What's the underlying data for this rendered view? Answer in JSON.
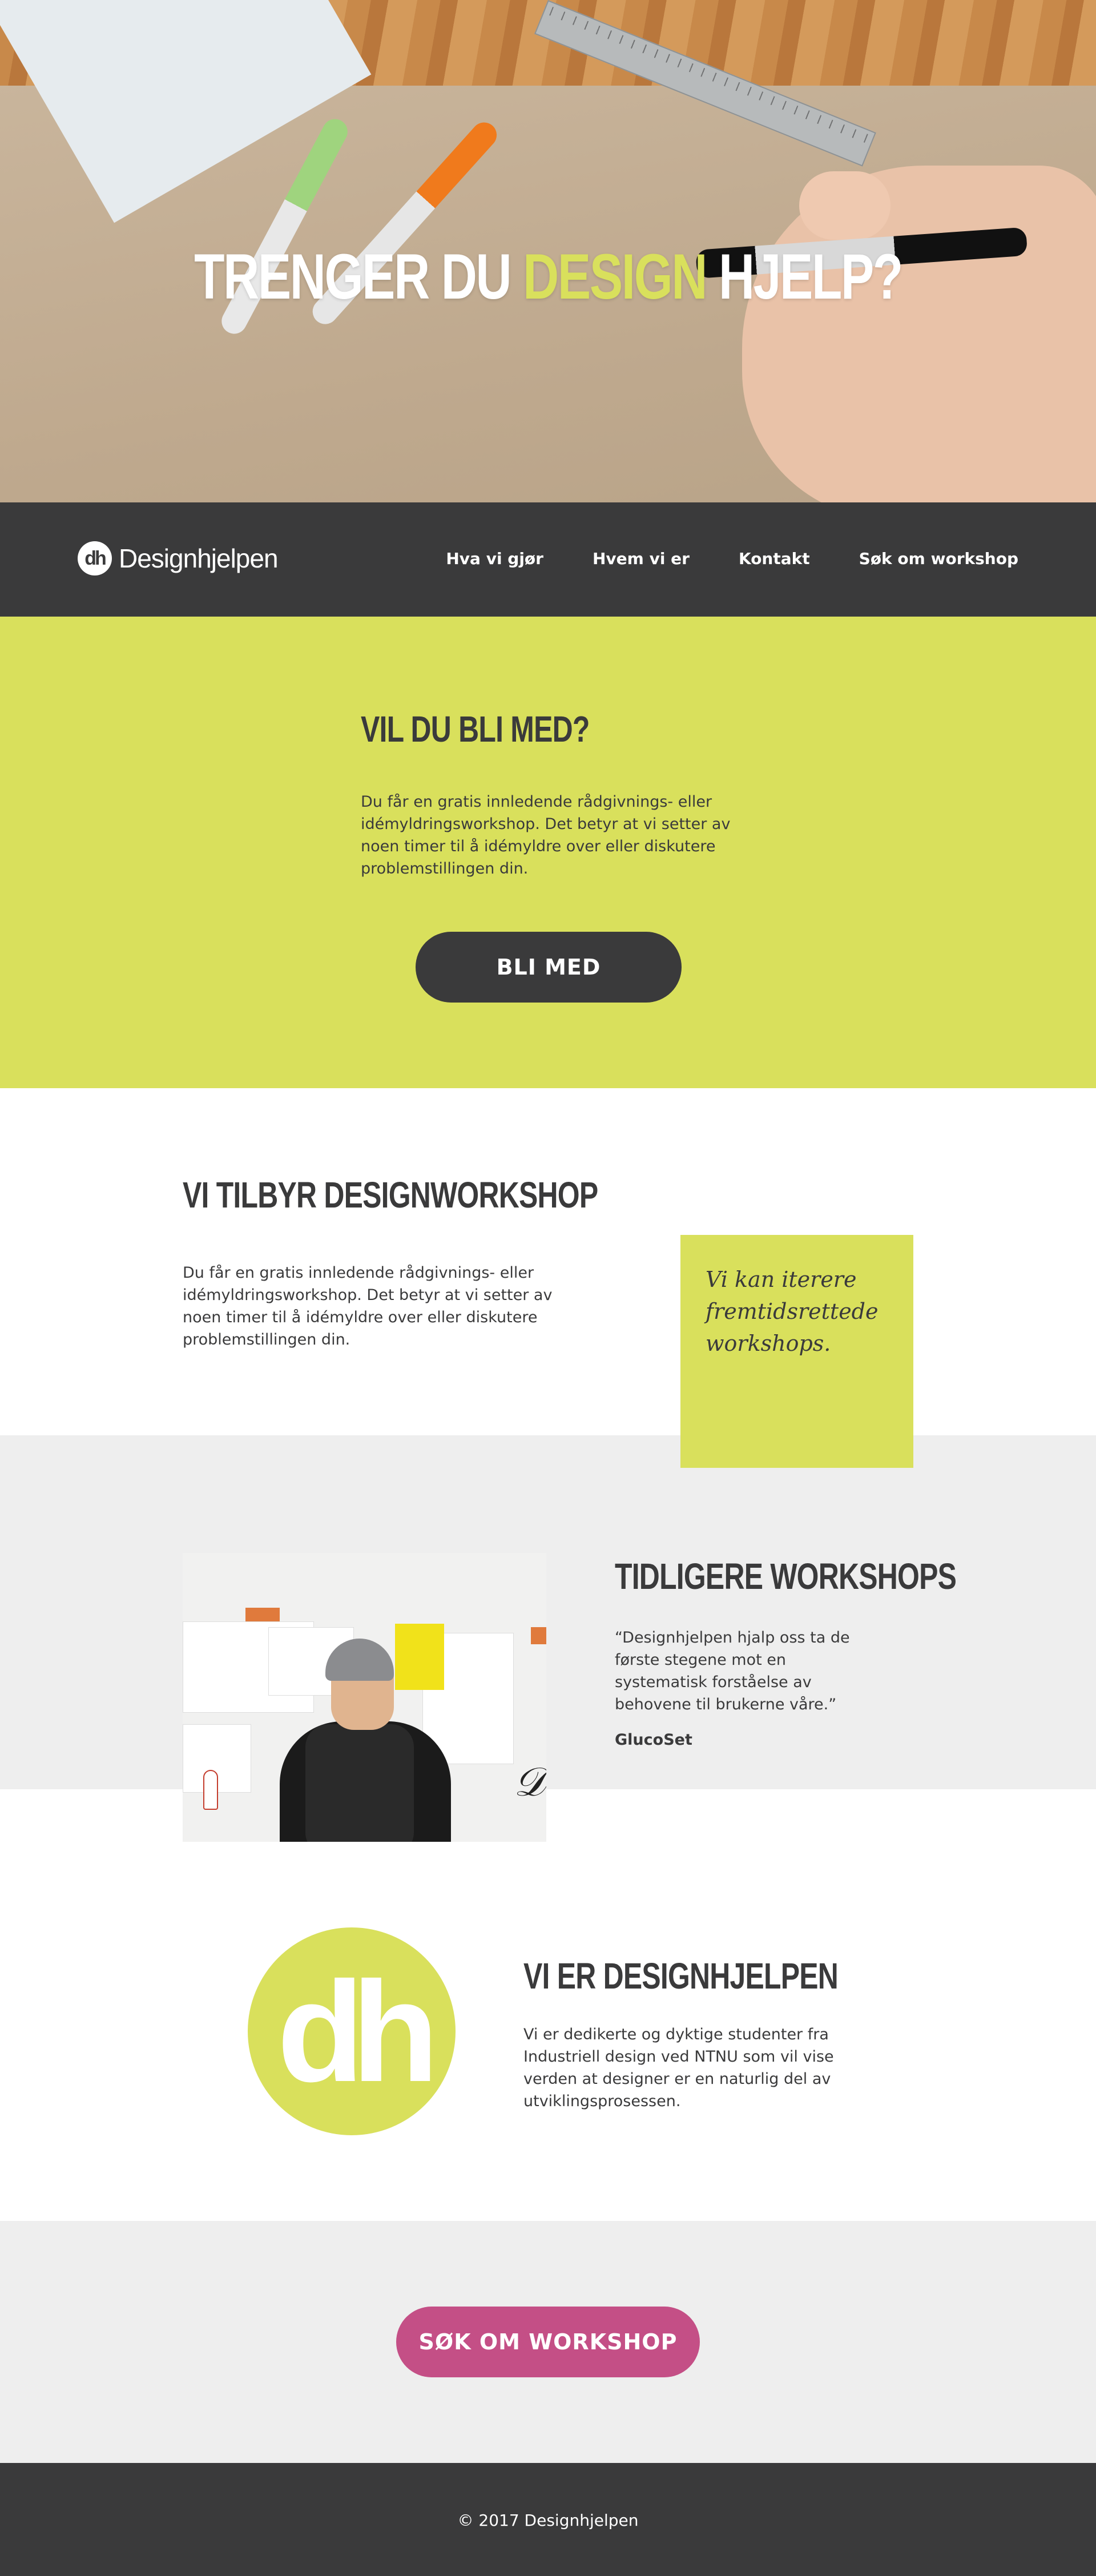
{
  "hero": {
    "title_part1": "TRENGER DU",
    "title_accent": "DESIGN",
    "title_part2": "HJELP?"
  },
  "nav": {
    "logo_mark": "dh",
    "logo_text": "Designhjelpen",
    "links": [
      "Hva vi gjør",
      "Hvem vi er",
      "Kontakt",
      "Søk om workshop"
    ]
  },
  "join": {
    "heading": "VIL DU BLI MED?",
    "text": "Du får en gratis innledende rådgivnings- eller idémyldringsworkshop. Det betyr at vi setter av noen timer til å idémyldre over eller diskutere problemstillingen din.",
    "button": "BLI MED"
  },
  "offer": {
    "heading": "VI TILBYR DESIGNWORKSHOP",
    "text": "Du får en gratis innledende rådgivnings- eller idémyldringsworkshop. Det betyr at vi setter av noen timer til å idémyldre over eller diskutere problemstillingen din.",
    "note": "Vi kan iterere fremtidsrettede workshops."
  },
  "previous": {
    "heading": "TIDLIGERE WORKSHOPS",
    "quote": "“Designhjelpen hjalp oss ta de første stegene mot en systematisk forståelse av behovene til brukerne våre.”",
    "author": "GlucoSet"
  },
  "about": {
    "logo_mark": "dh",
    "heading": "VI ER DESIGNHJELPEN",
    "text": "Vi er dedikerte og dyktige studenter fra Industriell design ved NTNU som vil vise verden at designer er en naturlig del av utviklingsprosessen."
  },
  "cta": {
    "button": "SØK OM WORKSHOP"
  },
  "footer": {
    "text": "© 2017 Designhjelpen"
  },
  "colors": {
    "accent_yellow": "#d9e05c",
    "dark": "#3a3a3b",
    "pink": "#c44f86",
    "light_gray": "#eeeeee"
  }
}
